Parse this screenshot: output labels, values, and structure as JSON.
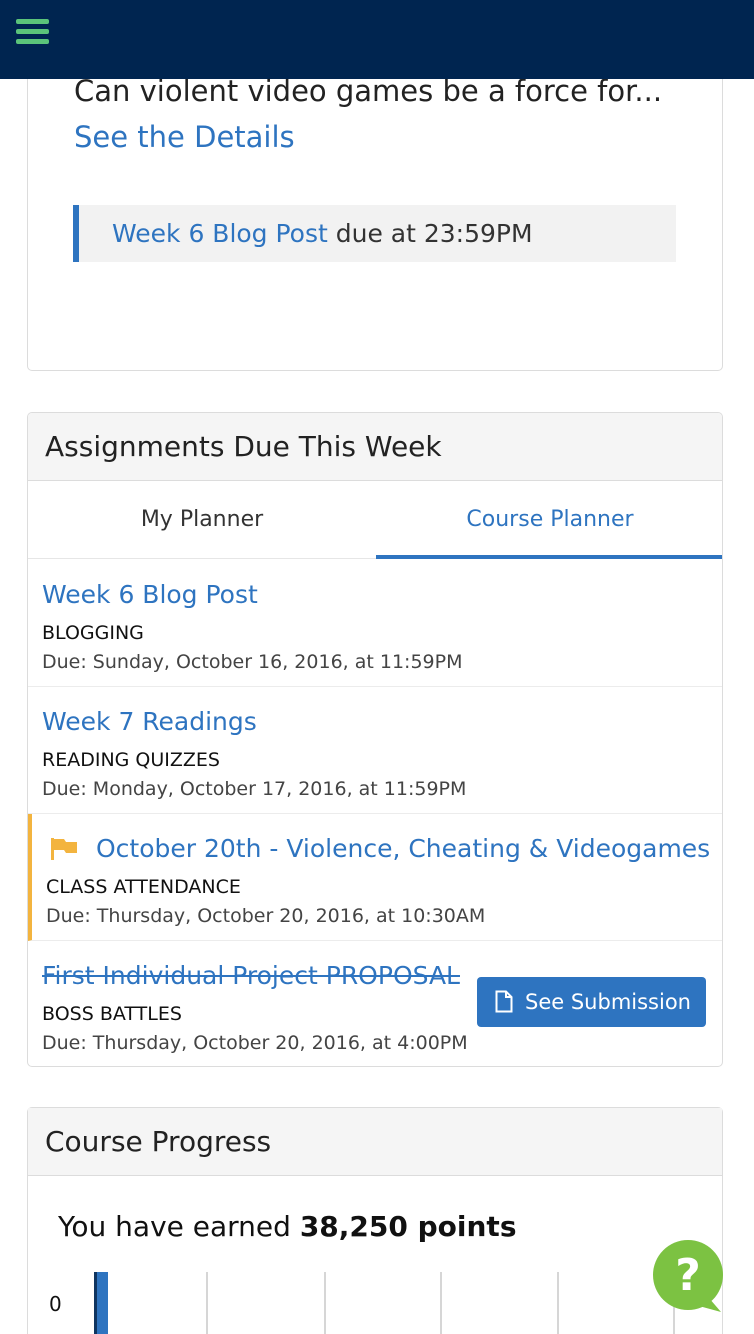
{
  "header": {
    "menu_icon": "hamburger-icon"
  },
  "announcement": {
    "teaser_text": "Can violent video games be a force for... ",
    "details_link": "See the Details",
    "due_link": "Week 6 Blog Post",
    "due_suffix": " due at 23:59PM"
  },
  "assignments": {
    "title": "Assignments Due This Week",
    "tabs": [
      {
        "label": "My Planner",
        "active": false
      },
      {
        "label": "Course Planner",
        "active": true
      }
    ],
    "items": [
      {
        "title": "Week 6 Blog Post",
        "category": "BLOGGING",
        "due": "Due: Sunday, October 16, 2016, at 11:59PM"
      },
      {
        "title": "Week 7 Readings",
        "category": "READING QUIZZES",
        "due": "Due: Monday, October 17, 2016, at 11:59PM"
      },
      {
        "title": "October 20th - Violence, Cheating & Videogames",
        "category": "CLASS ATTENDANCE",
        "due": "Due: Thursday, October 20, 2016, at 10:30AM",
        "flag_icon": "flag-icon"
      },
      {
        "title": "First Individual Project PROPOSAL",
        "category": "BOSS BATTLES",
        "due": "Due: Thursday, October 20, 2016, at 4:00PM",
        "button_label": "See Submission",
        "button_icon": "document-icon"
      }
    ],
    "accent_color": "#2e74c0",
    "flag_color": "#f3b43f"
  },
  "progress": {
    "title": "Course Progress",
    "earned_prefix": "You have earned ",
    "earned_value": "38,250 points",
    "axis_zero": "0"
  },
  "help": {
    "icon": "help-question-icon"
  }
}
